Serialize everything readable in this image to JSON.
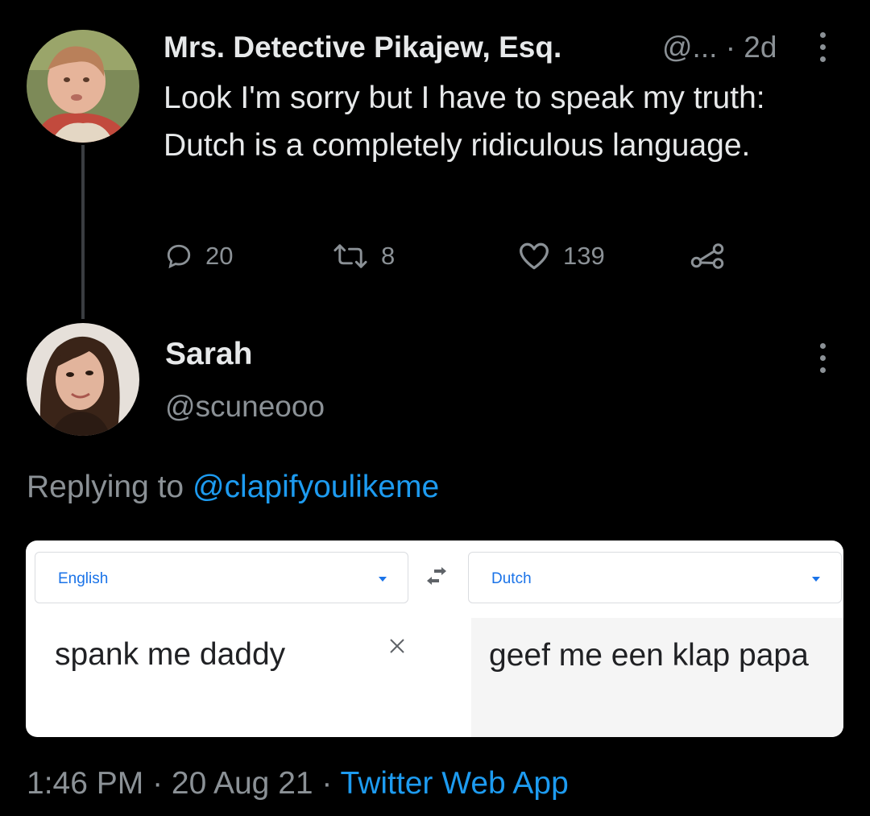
{
  "top_tweet": {
    "author_name": "Mrs. Detective Pikajew, Esq.",
    "author_handle": "@...",
    "age": "· 2d",
    "text": "Look I'm sorry but I have to speak my truth: Dutch is a completely ridiculous language.",
    "reply_count": "20",
    "retweet_count": "8",
    "like_count": "139"
  },
  "reply_tweet": {
    "author_name": "Sarah",
    "author_handle": "@scuneooo",
    "replying_prefix": "Replying to ",
    "replying_handle": "@clapifyoulikeme",
    "translate": {
      "source_language": "English",
      "target_language": "Dutch",
      "source_text": "spank me daddy",
      "translated_text": "geef me een klap papa"
    },
    "timestamp": "1:46 PM · 20 Aug 21 · ",
    "client": "Twitter Web App"
  },
  "colors": {
    "background": "#000000",
    "text_primary": "#e7e9ea",
    "text_secondary": "#8b9196",
    "link": "#1d9bf0",
    "translate_accent": "#1a73e8"
  }
}
